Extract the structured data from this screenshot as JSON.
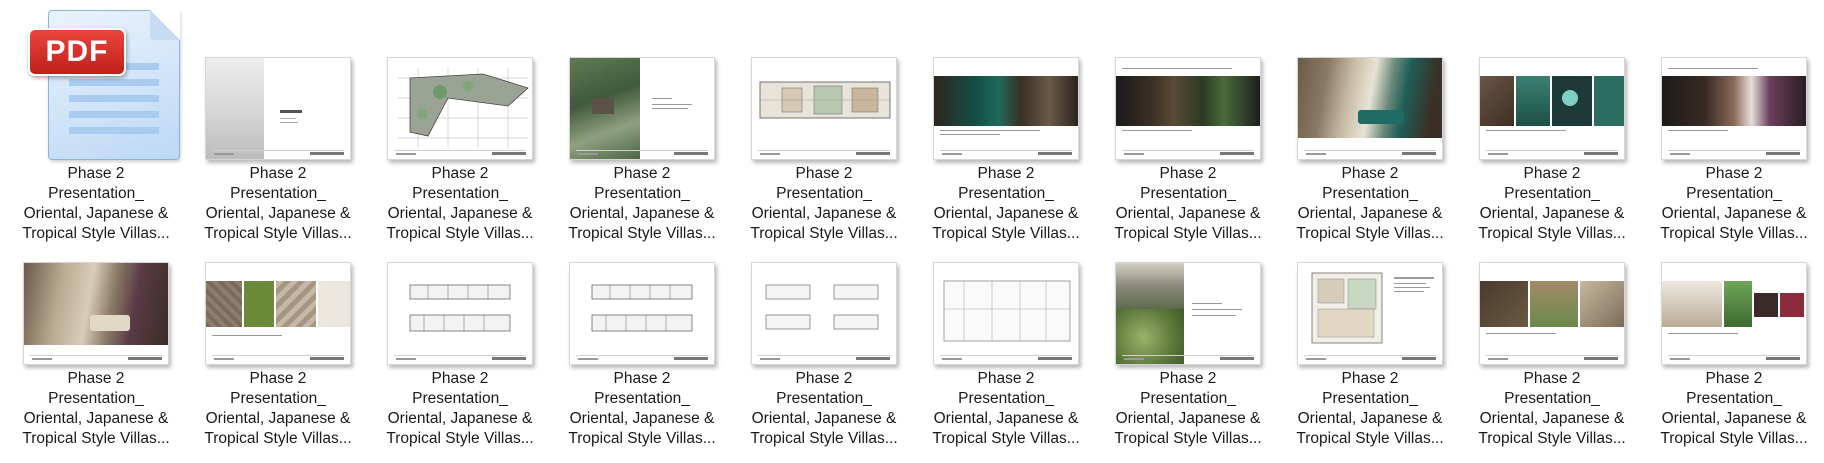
{
  "window": {
    "view": "large-icons"
  },
  "badge_text": "PDF",
  "files": [
    {
      "line1": "Phase 2",
      "line2": "Presentation_",
      "line3": "Oriental, Japanese &",
      "line4": "Tropical Style Villas...",
      "kind": "pdf-icon"
    },
    {
      "line1": "Phase 2",
      "line2": "Presentation_",
      "line3": "Oriental, Japanese &",
      "line4": "Tropical Style Villas...",
      "kind": "cover"
    },
    {
      "line1": "Phase 2",
      "line2": "Presentation_",
      "line3": "Oriental, Japanese &",
      "line4": "Tropical Style Villas...",
      "kind": "siteplan"
    },
    {
      "line1": "Phase 2",
      "line2": "Presentation_",
      "line3": "Oriental, Japanese &",
      "line4": "Tropical Style Villas...",
      "kind": "aerial"
    },
    {
      "line1": "Phase 2",
      "line2": "Presentation_",
      "line3": "Oriental, Japanese &",
      "line4": "Tropical Style Villas...",
      "kind": "floorplan"
    },
    {
      "line1": "Phase 2",
      "line2": "Presentation_",
      "line3": "Oriental, Japanese &",
      "line4": "Tropical Style Villas...",
      "kind": "photo-green"
    },
    {
      "line1": "Phase 2",
      "line2": "Presentation_",
      "line3": "Oriental, Japanese &",
      "line4": "Tropical Style Villas...",
      "kind": "photo-dark"
    },
    {
      "line1": "Phase 2",
      "line2": "Presentation_",
      "line3": "Oriental, Japanese &",
      "line4": "Tropical Style Villas...",
      "kind": "photo-full"
    },
    {
      "line1": "Phase 2",
      "line2": "Presentation_",
      "line3": "Oriental, Japanese &",
      "line4": "Tropical Style Villas...",
      "kind": "photo-teal"
    },
    {
      "line1": "Phase 2",
      "line2": "Presentation_",
      "line3": "Oriental, Japanese &",
      "line4": "Tropical Style Villas...",
      "kind": "photo-bedroom"
    },
    {
      "line1": "Phase 2",
      "line2": "Presentation_",
      "line3": "Oriental, Japanese &",
      "line4": "Tropical Style Villas...",
      "kind": "photo-living"
    },
    {
      "line1": "Phase 2",
      "line2": "Presentation_",
      "line3": "Oriental, Japanese &",
      "line4": "Tropical Style Villas...",
      "kind": "materials"
    },
    {
      "line1": "Phase 2",
      "line2": "Presentation_",
      "line3": "Oriental, Japanese &",
      "line4": "Tropical Style Villas...",
      "kind": "elevation"
    },
    {
      "line1": "Phase 2",
      "line2": "Presentation_",
      "line3": "Oriental, Japanese &",
      "line4": "Tropical Style Villas...",
      "kind": "elevation"
    },
    {
      "line1": "Phase 2",
      "line2": "Presentation_",
      "line3": "Oriental, Japanese &",
      "line4": "Tropical Style Villas...",
      "kind": "elevation-4"
    },
    {
      "line1": "Phase 2",
      "line2": "Presentation_",
      "line3": "Oriental, Japanese &",
      "line4": "Tropical Style Villas...",
      "kind": "section"
    },
    {
      "line1": "Phase 2",
      "line2": "Presentation_",
      "line3": "Oriental, Japanese &",
      "line4": "Tropical Style Villas...",
      "kind": "garden"
    },
    {
      "line1": "Phase 2",
      "line2": "Presentation_",
      "line3": "Oriental, Japanese &",
      "line4": "Tropical Style Villas...",
      "kind": "floorplan-2"
    },
    {
      "line1": "Phase 2",
      "line2": "Presentation_",
      "line3": "Oriental, Japanese &",
      "line4": "Tropical Style Villas...",
      "kind": "photo-brown"
    },
    {
      "line1": "Phase 2",
      "line2": "Presentation_",
      "line3": "Oriental, Japanese &",
      "line4": "Tropical Style Villas...",
      "kind": "photo-furniture"
    }
  ]
}
